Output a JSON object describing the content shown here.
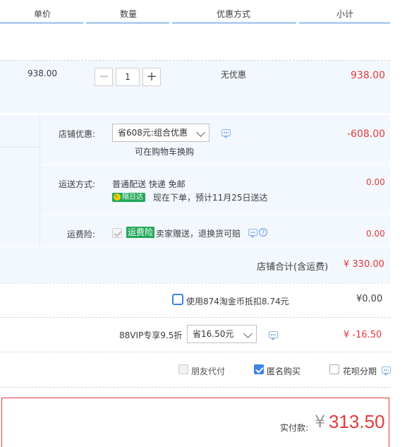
{
  "columns": [
    "单价",
    "数量",
    "优惠方式",
    "小计"
  ],
  "item": {
    "unit_price": "938.00",
    "quantity": "1",
    "minus": "−",
    "plus": "+",
    "discount": "无优惠",
    "subtotal": "938.00"
  },
  "shop_promo": {
    "label": "店铺优惠:",
    "selected": "省608元:组合优惠",
    "note": "可在购物车换购",
    "amount": "-608.00"
  },
  "shipping": {
    "label": "运送方式:",
    "method": "普通配送 快递 免邮",
    "badge": "隔日达",
    "eta": "现在下单，预计11月25日送达",
    "amount": "0.00"
  },
  "insurance": {
    "label": "运费险:",
    "tag": "运费险",
    "text": "卖家赠送，退换货可赔",
    "amount": "0.00"
  },
  "shop_total": {
    "label": "店铺合计(含运费)",
    "value": "¥ 330.00"
  },
  "coins": {
    "label": "使用874淘金币抵扣8.74元",
    "amount": "¥0.00"
  },
  "vip": {
    "label": "88VIP专享9.5折",
    "selected": "省16.50元",
    "amount": "¥ -16.50"
  },
  "options": {
    "friend_pay": "朋友代付",
    "anonymous": "匿名购买",
    "installment": "花呗分期"
  },
  "payment": {
    "label": "实付款:",
    "currency": "¥",
    "amount": "313.50"
  },
  "colors": {
    "accent_red": "#e4393c",
    "accent_blue": "#3f84e3",
    "green_tag": "#21a85a"
  }
}
